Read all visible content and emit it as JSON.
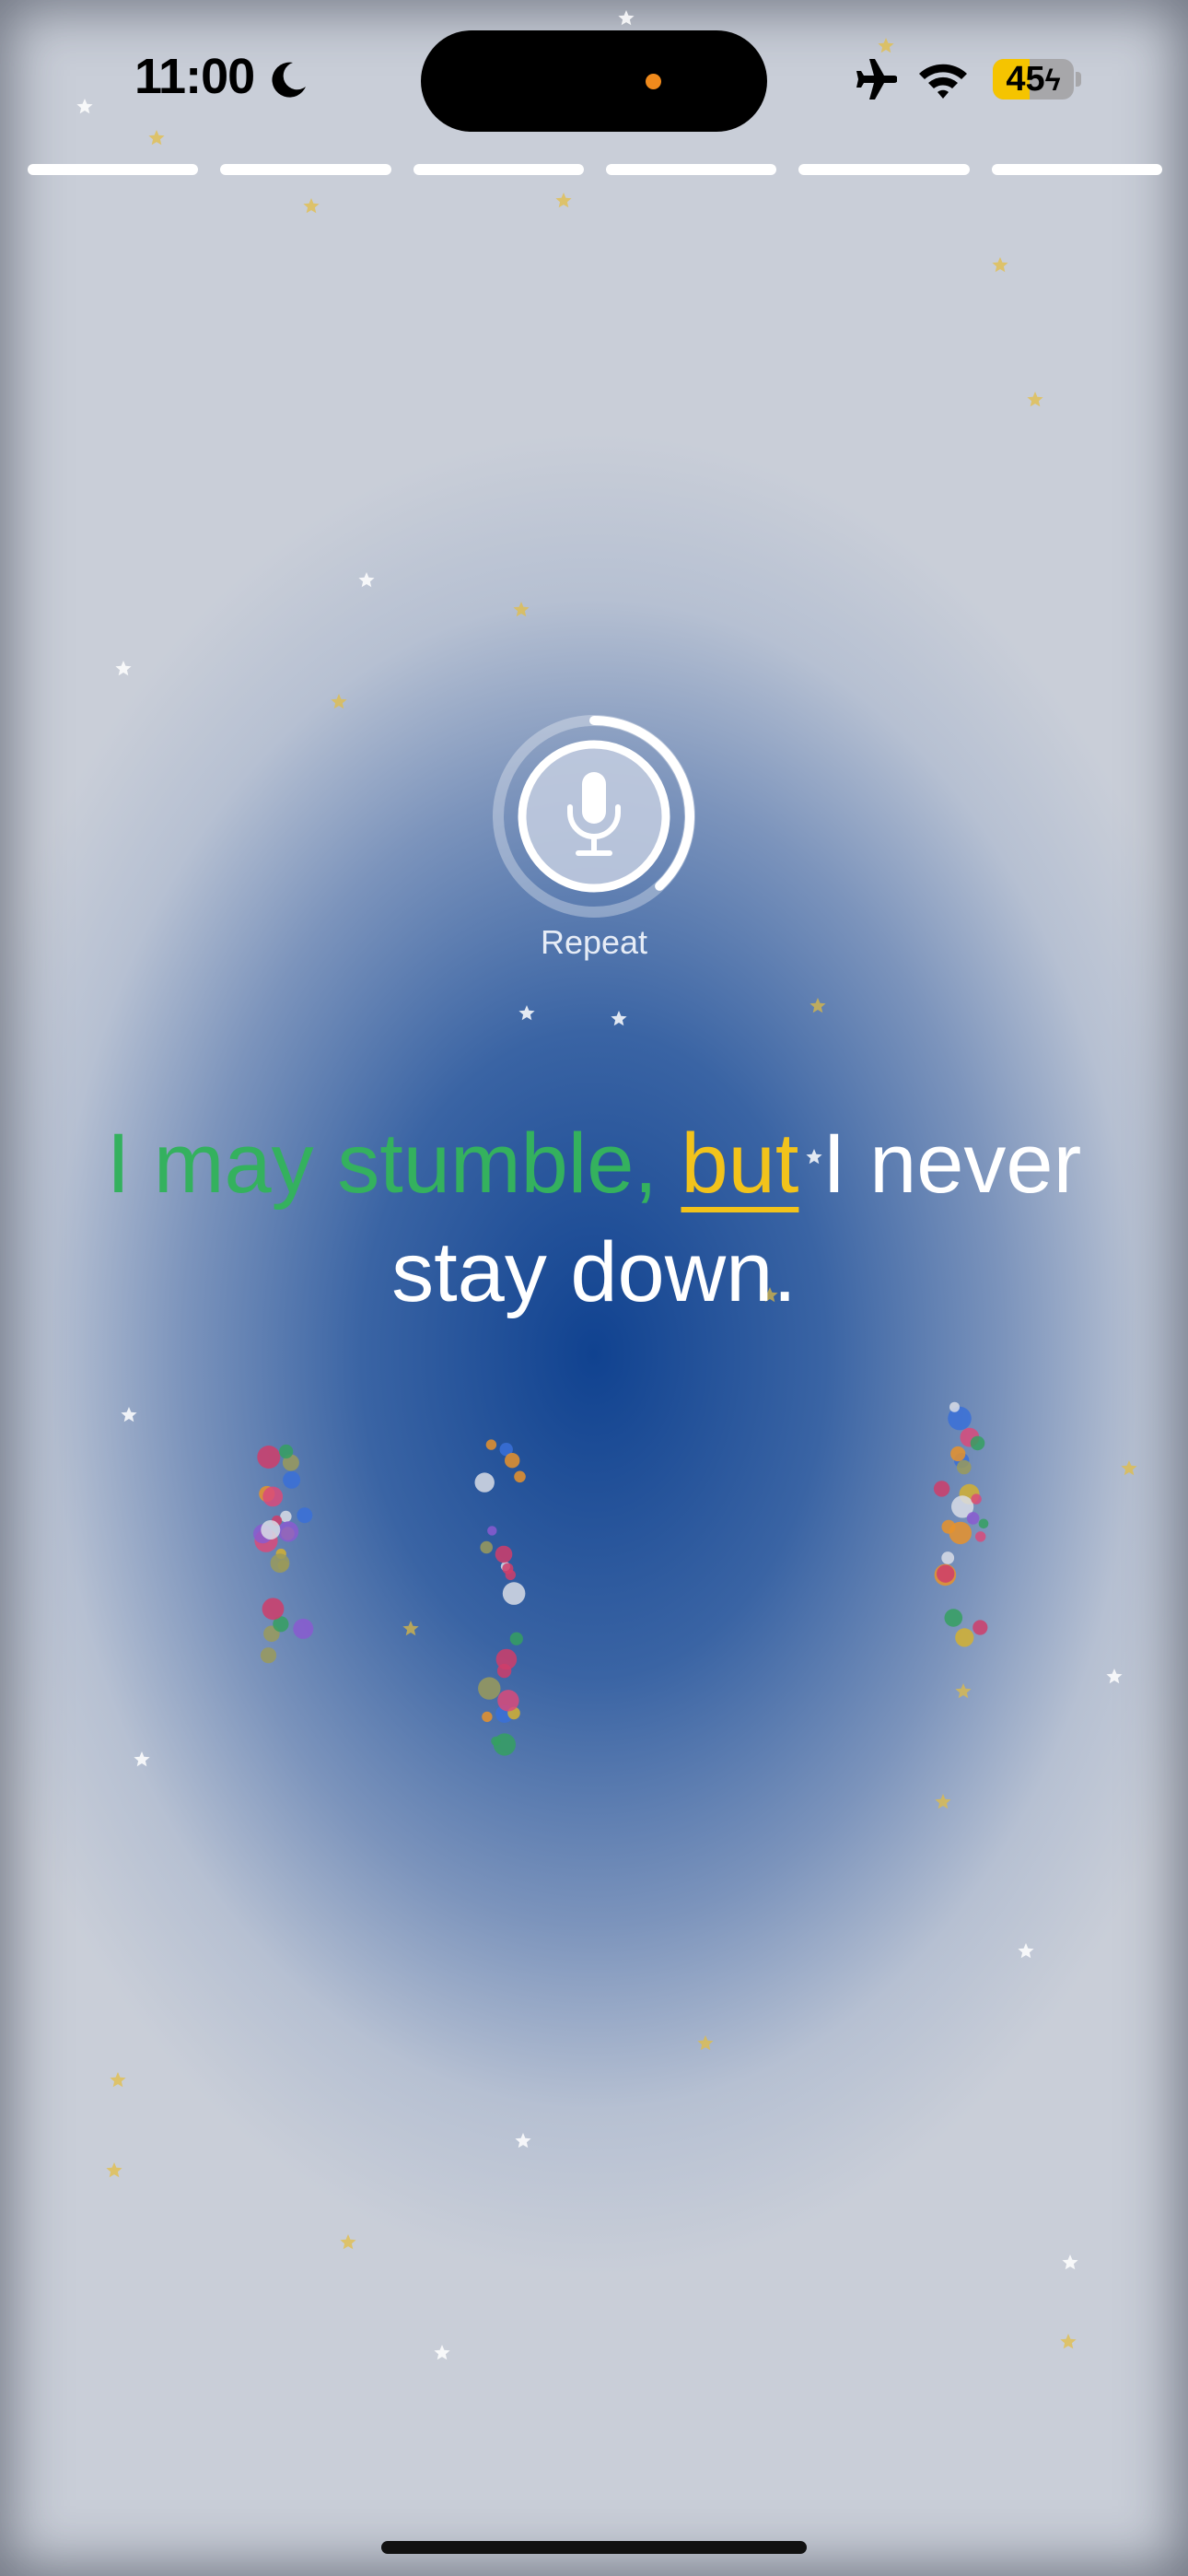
{
  "status_bar": {
    "time": "11:00",
    "battery_level": "45",
    "battery_fraction": 0.45,
    "icons": [
      "moon-icon",
      "airplane-icon",
      "wifi-icon",
      "battery-charging-icon"
    ]
  },
  "progress": {
    "total_segments": 6
  },
  "mic": {
    "label": "Repeat",
    "icon": "microphone-icon",
    "countdown_fraction": 0.38
  },
  "sentence": {
    "done": "I may stumble,",
    "current": "but",
    "rest": "I never stay down."
  },
  "colors": {
    "done": "#34b15e",
    "current": "#f2c31b",
    "text": "#ffffff",
    "background_center": "#104290",
    "background_edge": "#c9ced8"
  }
}
